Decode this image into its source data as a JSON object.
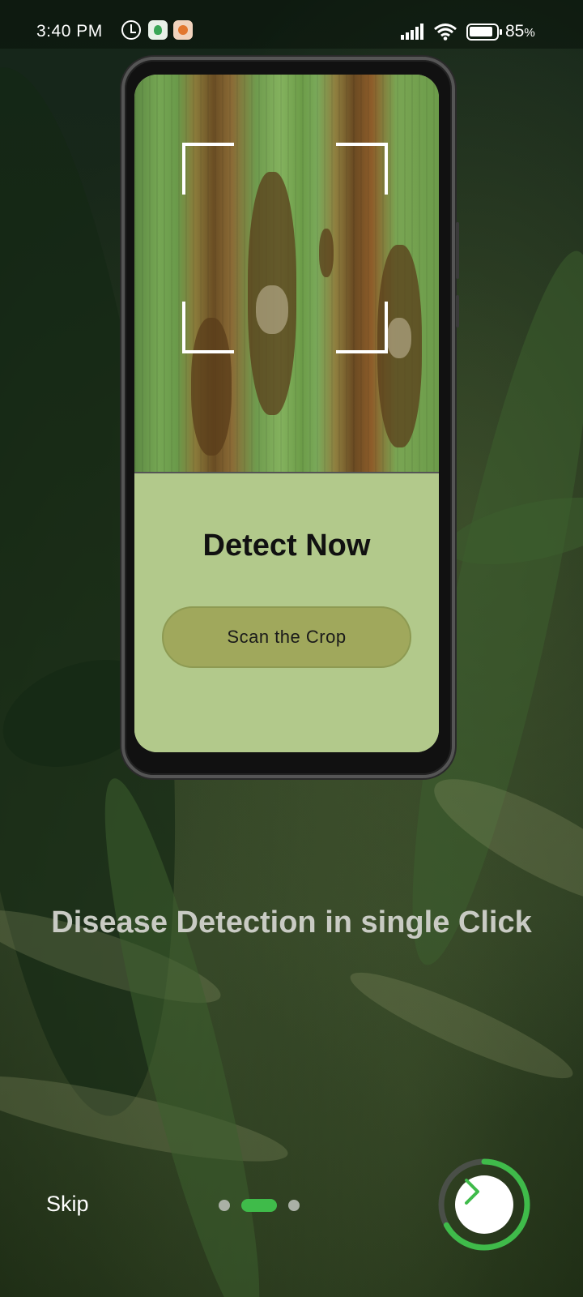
{
  "status_bar": {
    "time": "3:40  PM",
    "battery_percent": "85"
  },
  "illustration": {
    "title": "Detect Now",
    "scan_button_label": "Scan the Crop"
  },
  "caption": "Disease Detection in single Click",
  "controls": {
    "skip_label": "Skip",
    "page_count": 3,
    "current_page": 2,
    "next_progress": 0.67
  },
  "colors": {
    "accent": "#3fbb4a",
    "panel": "#b2c98b",
    "scan_button": "#a0a85c"
  },
  "icons": [
    "alarm-icon",
    "app-notification-icon",
    "signal-icon",
    "wifi-icon",
    "battery-icon",
    "chevron-right-icon"
  ]
}
